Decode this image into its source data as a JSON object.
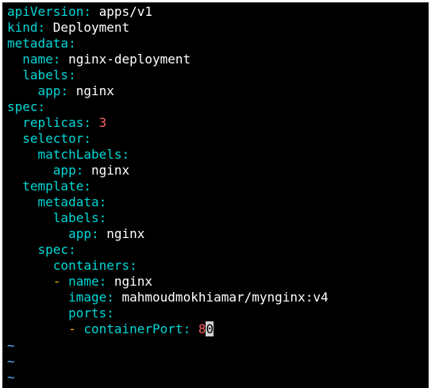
{
  "lines": [
    {
      "indent": "",
      "key": "apiVersion",
      "sep": ": ",
      "value": "apps/v1"
    },
    {
      "indent": "",
      "key": "kind",
      "sep": ": ",
      "value": "Deployment"
    },
    {
      "indent": "",
      "key": "metadata",
      "sep": ":",
      "value": ""
    },
    {
      "indent": "  ",
      "key": "name",
      "sep": ": ",
      "value": "nginx-deployment"
    },
    {
      "indent": "  ",
      "key": "labels",
      "sep": ":",
      "value": ""
    },
    {
      "indent": "    ",
      "key": "app",
      "sep": ": ",
      "value": "nginx"
    },
    {
      "indent": "",
      "key": "spec",
      "sep": ":",
      "value": ""
    },
    {
      "indent": "  ",
      "key": "replicas",
      "sep": ": ",
      "number": "3"
    },
    {
      "indent": "  ",
      "key": "selector",
      "sep": ":",
      "value": ""
    },
    {
      "indent": "    ",
      "key": "matchLabels",
      "sep": ":",
      "value": ""
    },
    {
      "indent": "      ",
      "key": "app",
      "sep": ": ",
      "value": "nginx"
    },
    {
      "indent": "  ",
      "key": "template",
      "sep": ":",
      "value": ""
    },
    {
      "indent": "    ",
      "key": "metadata",
      "sep": ":",
      "value": ""
    },
    {
      "indent": "      ",
      "key": "labels",
      "sep": ":",
      "value": ""
    },
    {
      "indent": "        ",
      "key": "app",
      "sep": ": ",
      "value": "nginx"
    },
    {
      "indent": "    ",
      "key": "spec",
      "sep": ":",
      "value": ""
    },
    {
      "indent": "      ",
      "key": "containers",
      "sep": ":",
      "value": ""
    },
    {
      "indent": "      ",
      "dash": "- ",
      "key": "name",
      "sep": ": ",
      "value": "nginx"
    },
    {
      "indent": "        ",
      "key": "image",
      "sep": ": ",
      "value": "mahmoudmokhiamar/mynginx:v4"
    },
    {
      "indent": "        ",
      "key": "ports",
      "sep": ":",
      "value": ""
    },
    {
      "indent": "        ",
      "dash": "- ",
      "key": "containerPort",
      "sep": ": ",
      "number": "8",
      "cursor": "0"
    }
  ],
  "tildes": [
    "~",
    "~",
    "~"
  ],
  "colors": {
    "background": "#000000",
    "key": "#00d7d7",
    "value": "#ffffff",
    "number": "#ff5f5f",
    "dash": "#ffaf00",
    "tilde": "#5fafff",
    "cursor": "#d0d0d0"
  }
}
